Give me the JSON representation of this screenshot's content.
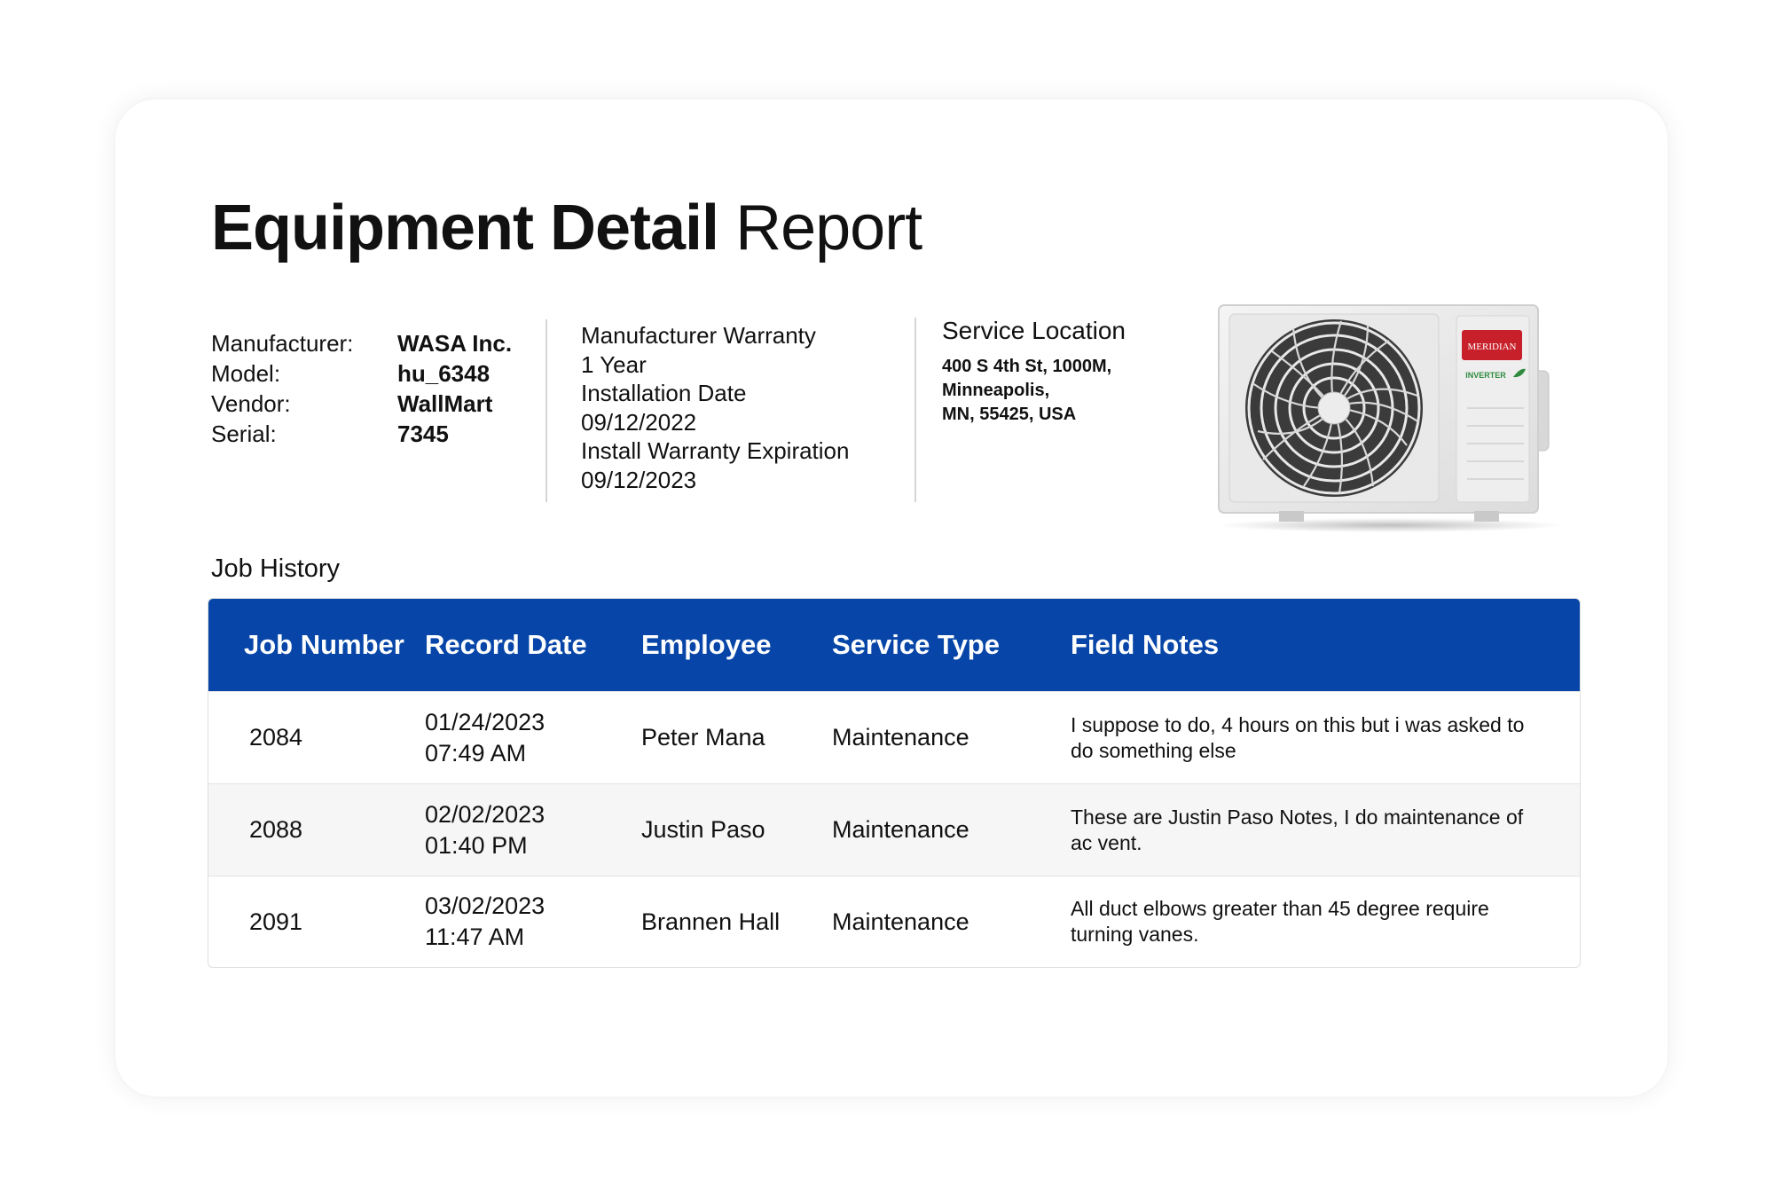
{
  "report": {
    "title_bold": "Equipment Detail",
    "title_regular": " Report"
  },
  "specs": [
    {
      "label": "Manufacturer:",
      "value": "WASA Inc."
    },
    {
      "label": "Model:",
      "value": "hu_6348"
    },
    {
      "label": "Vendor:",
      "value": "WallMart"
    },
    {
      "label": "Serial:",
      "value": "7345"
    }
  ],
  "warranty": {
    "manufacturer_warranty_label": "Manufacturer Warranty",
    "manufacturer_warranty_value": "1 Year",
    "installation_date_label": "Installation Date",
    "installation_date_value": "09/12/2022",
    "install_expiration_label": "Install Warranty Expiration",
    "install_expiration_value": "09/12/2023"
  },
  "location": {
    "title": "Service Location",
    "line1": "400 S 4th St, 1000M,",
    "line2": "Minneapolis,",
    "line3": "MN, 55425, USA"
  },
  "equipment_image": {
    "brand": "MERIDIAN",
    "label": "INVERTER",
    "brand_color": "#c8202a",
    "label_color": "#2e8b3e"
  },
  "job_history": {
    "title": "Job History",
    "columns": [
      "Job Number",
      "Record Date",
      "Employee",
      "Service Type",
      "Field Notes"
    ],
    "rows": [
      {
        "job": "2084",
        "date": "01/24/2023",
        "time": "07:49 AM",
        "employee": "Peter Mana",
        "service": "Maintenance",
        "notes": "I suppose to do, 4 hours on this but i was asked to do something else"
      },
      {
        "job": "2088",
        "date": "02/02/2023",
        "time": "01:40 PM",
        "employee": "Justin Paso",
        "service": "Maintenance",
        "notes": "These are Justin Paso Notes, I do maintenance of ac vent."
      },
      {
        "job": "2091",
        "date": "03/02/2023",
        "time": "11:47 AM",
        "employee": "Brannen Hall",
        "service": "Maintenance",
        "notes": "All duct elbows greater than 45 degree require turning vanes."
      }
    ]
  },
  "colors": {
    "header_blue": "#0746a8",
    "row_alt": "#f6f6f6",
    "divider": "#d6d6d6"
  }
}
